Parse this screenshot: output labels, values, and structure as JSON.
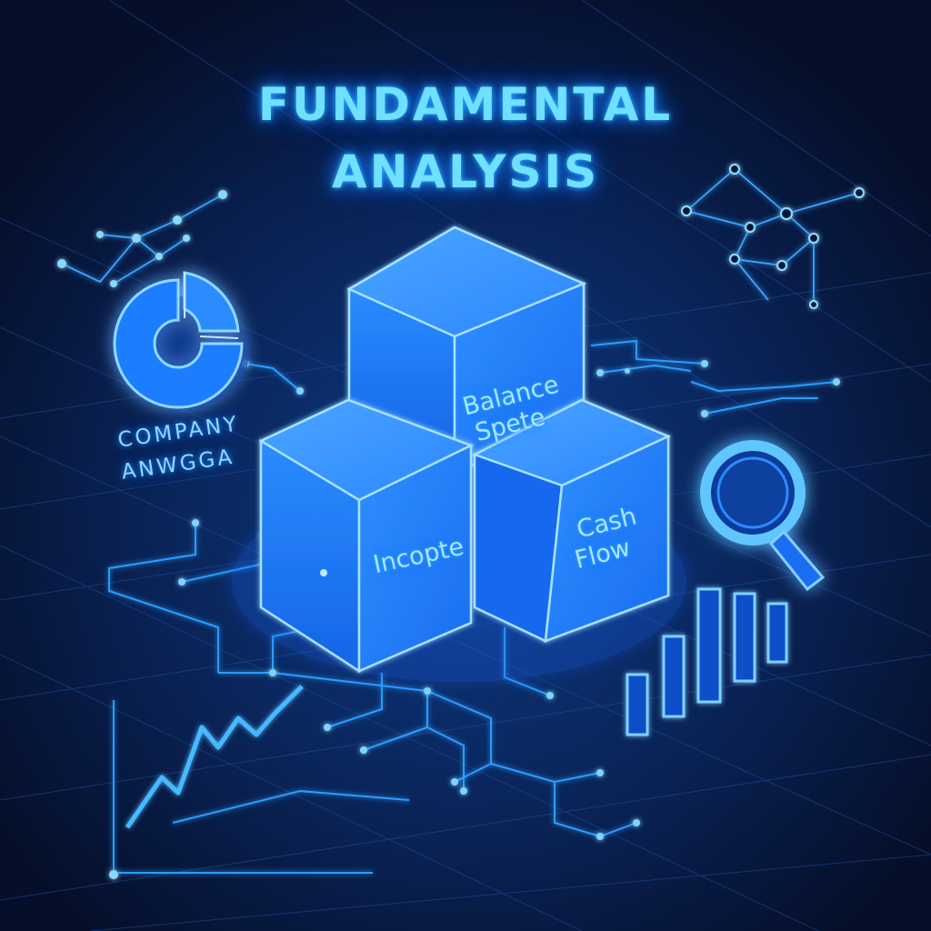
{
  "title": {
    "line1": "FUNDAMENTAL",
    "line2": "ANALYSIS"
  },
  "caption": {
    "line1": "COMPANY",
    "line2": "ANWGGA"
  },
  "cubes": {
    "balance_line1": "Balance",
    "balance_line2": "Spete",
    "cashflow_line1": "Cash",
    "cashflow_line2": "Flow",
    "income": "Incopte"
  },
  "icons": {
    "pie": "pie-chart-icon",
    "magnifier": "magnifying-glass-icon",
    "bars": "bar-chart-icon",
    "line": "line-chart-icon",
    "network": "network-graph-icon"
  },
  "colors": {
    "background": "#061634",
    "glow": "#2aa8ff",
    "title": "#6fe0ff",
    "cube_face": "#1b7cff"
  }
}
